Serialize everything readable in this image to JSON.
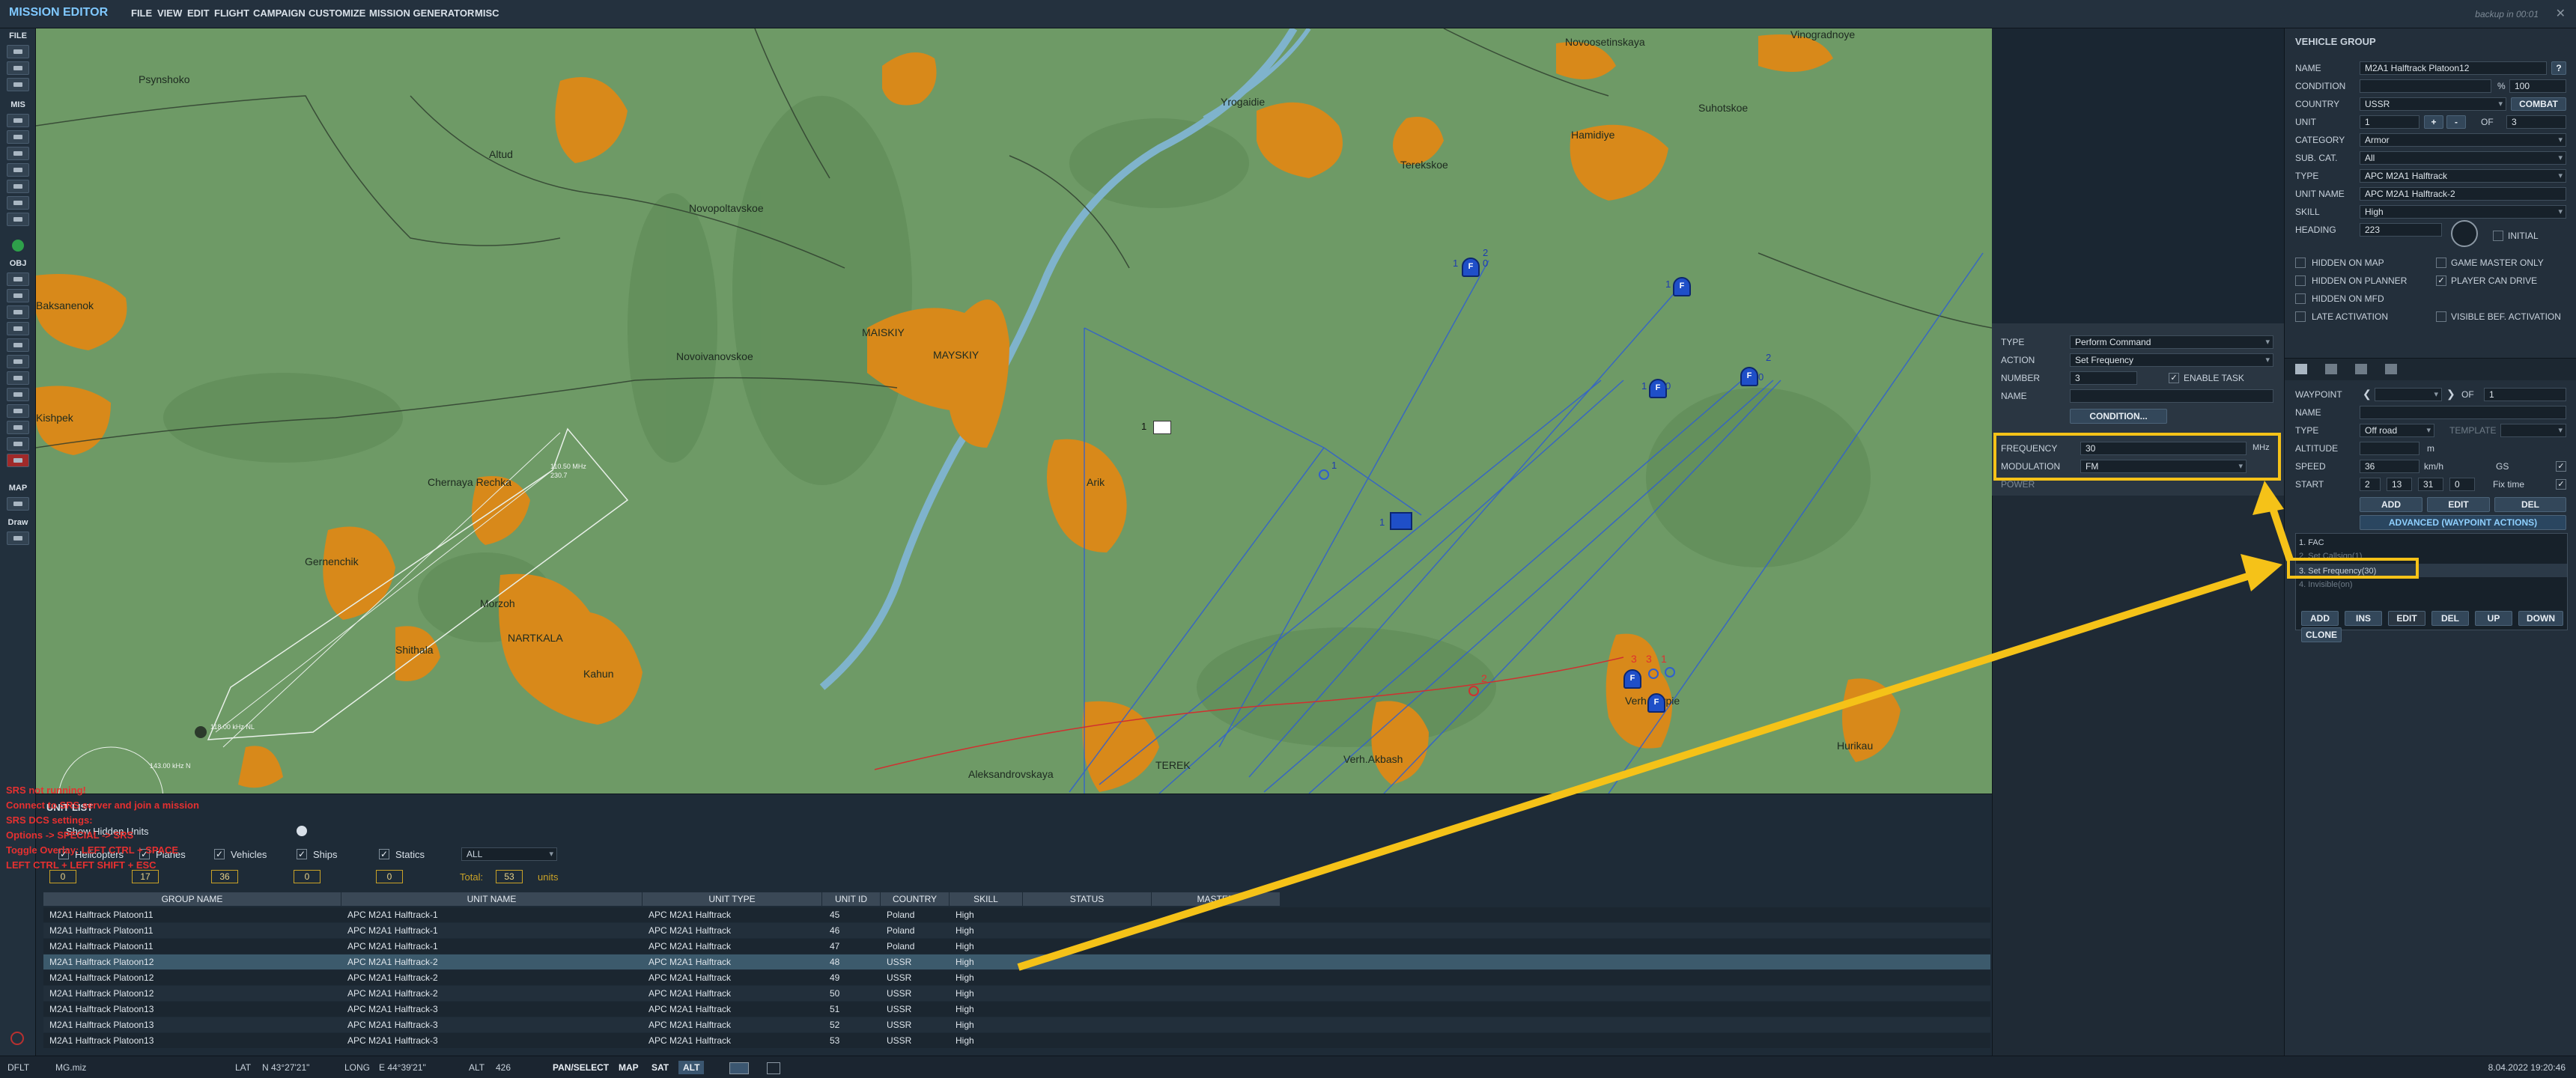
{
  "titlebar": {
    "app_title": "MISSION EDITOR",
    "menu": [
      "FILE",
      "VIEW",
      "EDIT",
      "FLIGHT",
      "CAMPAIGN",
      "CUSTOMIZE",
      "MISSION GENERATOR",
      "MISC"
    ],
    "backup_text": "backup in 00:01",
    "close_glyph": "✕"
  },
  "lefttool": {
    "sections": [
      "FILE",
      "MIS",
      "OBJ",
      "MAP"
    ],
    "draw_label": "Draw"
  },
  "map": {
    "towns": [
      "Psynshoko",
      "Altud",
      "Novopoltavskoe",
      "Baksanenok",
      "Kishpek",
      "Novoivanovskoe",
      "MAISKIY",
      "MAYSKIY",
      "Chernaya Rechka",
      "Gernenchik",
      "Shithala",
      "Morzoh",
      "NARTKALA",
      "Kahun",
      "Yrogaidie",
      "Terekskoe",
      "Hamidiye",
      "Novoosetinskaya",
      "Suhotskoe",
      "Arik",
      "Verh.Akbash",
      "TEREK",
      "Aleksandrovskaya",
      "Verh.Kurpie",
      "Hurikau",
      "Vinogradnoye"
    ],
    "freq_label": "110.50 MHz",
    "freq_label2": "230.7",
    "nav1": "118.00 kHz NL",
    "nav2": "143.00 kHz N",
    "unit_letter": "F",
    "labels_blue": [
      "1",
      "2",
      "0",
      "1",
      "0",
      "1",
      "0",
      "1",
      "2",
      "1"
    ],
    "red_nums": [
      "2",
      "3",
      "3",
      "1"
    ],
    "envelope_num": "1"
  },
  "srs": {
    "lines": [
      "SRS not running!",
      "Connect to SRS server and join a mission",
      "SRS DCS settings:",
      "Options -> SPECIAL -> SRS",
      "Toggle Overlay: LEFT CTRL + SPACE",
      "LEFT CTRL + LEFT SHIFT + ESC"
    ]
  },
  "unitlist": {
    "title": "UNIT LIST",
    "show_hidden": "Show Hidden Units",
    "filters": [
      {
        "label": "Helicopters",
        "count": "0"
      },
      {
        "label": "Planes",
        "count": "17"
      },
      {
        "label": "Vehicles",
        "count": "36"
      },
      {
        "label": "Ships",
        "count": "0"
      },
      {
        "label": "Statics",
        "count": "0"
      }
    ],
    "coalition": "ALL",
    "total_label": "Total:",
    "total_value": "53",
    "units_label": "units",
    "columns": [
      "GROUP NAME",
      "UNIT NAME",
      "UNIT TYPE",
      "UNIT ID",
      "COUNTRY",
      "SKILL",
      "STATUS",
      "MASTER"
    ],
    "rows": [
      [
        "M2A1 Halftrack Platoon11",
        "APC M2A1 Halftrack-1",
        "APC M2A1 Halftrack",
        "45",
        "Poland",
        "High"
      ],
      [
        "M2A1 Halftrack Platoon11",
        "APC M2A1 Halftrack-1",
        "APC M2A1 Halftrack",
        "46",
        "Poland",
        "High"
      ],
      [
        "M2A1 Halftrack Platoon11",
        "APC M2A1 Halftrack-1",
        "APC M2A1 Halftrack",
        "47",
        "Poland",
        "High"
      ],
      [
        "M2A1 Halftrack Platoon12",
        "APC M2A1 Halftrack-2",
        "APC M2A1 Halftrack",
        "48",
        "USSR",
        "High"
      ],
      [
        "M2A1 Halftrack Platoon12",
        "APC M2A1 Halftrack-2",
        "APC M2A1 Halftrack",
        "49",
        "USSR",
        "High"
      ],
      [
        "M2A1 Halftrack Platoon12",
        "APC M2A1 Halftrack-2",
        "APC M2A1 Halftrack",
        "50",
        "USSR",
        "High"
      ],
      [
        "M2A1 Halftrack Platoon13",
        "APC M2A1 Halftrack-3",
        "APC M2A1 Halftrack",
        "51",
        "USSR",
        "High"
      ],
      [
        "M2A1 Halftrack Platoon13",
        "APC M2A1 Halftrack-3",
        "APC M2A1 Halftrack",
        "52",
        "USSR",
        "High"
      ],
      [
        "M2A1 Halftrack Platoon13",
        "APC M2A1 Halftrack-3",
        "APC M2A1 Halftrack",
        "53",
        "USSR",
        "High"
      ]
    ]
  },
  "task": {
    "type_label": "TYPE",
    "type_value": "Perform Command",
    "action_label": "ACTION",
    "action_value": "Set Frequency",
    "number_label": "NUMBER",
    "number_value": "3",
    "enable_task": "ENABLE TASK",
    "name_label": "NAME",
    "condition_btn": "CONDITION...",
    "frequency_label": "FREQUENCY",
    "frequency_value": "30",
    "frequency_unit": "MHz",
    "modulation_label": "MODULATION",
    "modulation_value": "FM",
    "power_label": "POWER"
  },
  "vehicle_group": {
    "title": "VEHICLE GROUP",
    "name_label": "NAME",
    "name_value": "M2A1 Halftrack Platoon12",
    "help": "?",
    "condition_label": "CONDITION",
    "condition_pct": "%",
    "condition_value": "100",
    "country_label": "COUNTRY",
    "country_value": "USSR",
    "combat_btn": "COMBAT",
    "unit_label": "UNIT",
    "unit_value": "1",
    "unit_of": "OF",
    "unit_total": "3",
    "plus": "+",
    "minus": "-",
    "category_label": "CATEGORY",
    "category_value": "Armor",
    "subcat_label": "SUB. CAT.",
    "subcat_value": "All",
    "type_label": "TYPE",
    "type_value": "APC M2A1 Halftrack",
    "unitname_label": "UNIT NAME",
    "unitname_value": "APC M2A1 Halftrack-2",
    "skill_label": "SKILL",
    "skill_value": "High",
    "heading_label": "HEADING",
    "heading_value": "223",
    "initial_label": "INITIAL",
    "checks": [
      "HIDDEN ON MAP",
      "GAME MASTER ONLY",
      "HIDDEN ON PLANNER",
      "PLAYER CAN DRIVE",
      "HIDDEN ON MFD",
      "LATE ACTIVATION",
      "VISIBLE BEF. ACTIVATION"
    ]
  },
  "waypoint": {
    "waypoint_label": "WAYPOINT",
    "of": "OF",
    "wp_total": "1",
    "name_label": "NAME",
    "type_label": "TYPE",
    "type_value": "Off road",
    "template_label": "TEMPLATE",
    "altitude_label": "ALTITUDE",
    "altitude_unit": "m",
    "speed_label": "SPEED",
    "speed_value": "36",
    "speed_unit": "km/h",
    "gs_label": "GS",
    "start_label": "START",
    "start_d": "2",
    "start_h": "13",
    "start_m": "31",
    "start_s": "0",
    "fix_time": "Fix time",
    "add_btn": "ADD",
    "edit_btn": "EDIT",
    "del_btn": "DEL",
    "advanced_btn": "ADVANCED (WAYPOINT ACTIONS)",
    "actions": [
      "1. FAC",
      "2. Set Callsign(1)",
      "3. Set Frequency(30)",
      "4. Invisible(on)"
    ],
    "btns": [
      "ADD",
      "INS",
      "EDIT",
      "DEL",
      "UP",
      "DOWN"
    ],
    "clone_btn": "CLONE"
  },
  "statusbar": {
    "mode": "DFLT",
    "file": "MG.miz",
    "lat_label": "LAT",
    "lat_value": "N 43°27'21\"",
    "long_label": "LONG",
    "long_value": "E 44°39'21\"",
    "alt_label": "ALT",
    "alt_value": "426",
    "pan_select": "PAN/SELECT",
    "map_btn": "MAP",
    "sat_btn": "SAT",
    "alt_btn": "ALT",
    "datetime": "8.04.2022 19:20:46"
  },
  "colors": {
    "accent": "#f5c218",
    "map_green": "#6e9a66",
    "town_orange": "#d8891a",
    "unit_blue": "#1f4fc8",
    "red_route": "#e03030"
  }
}
